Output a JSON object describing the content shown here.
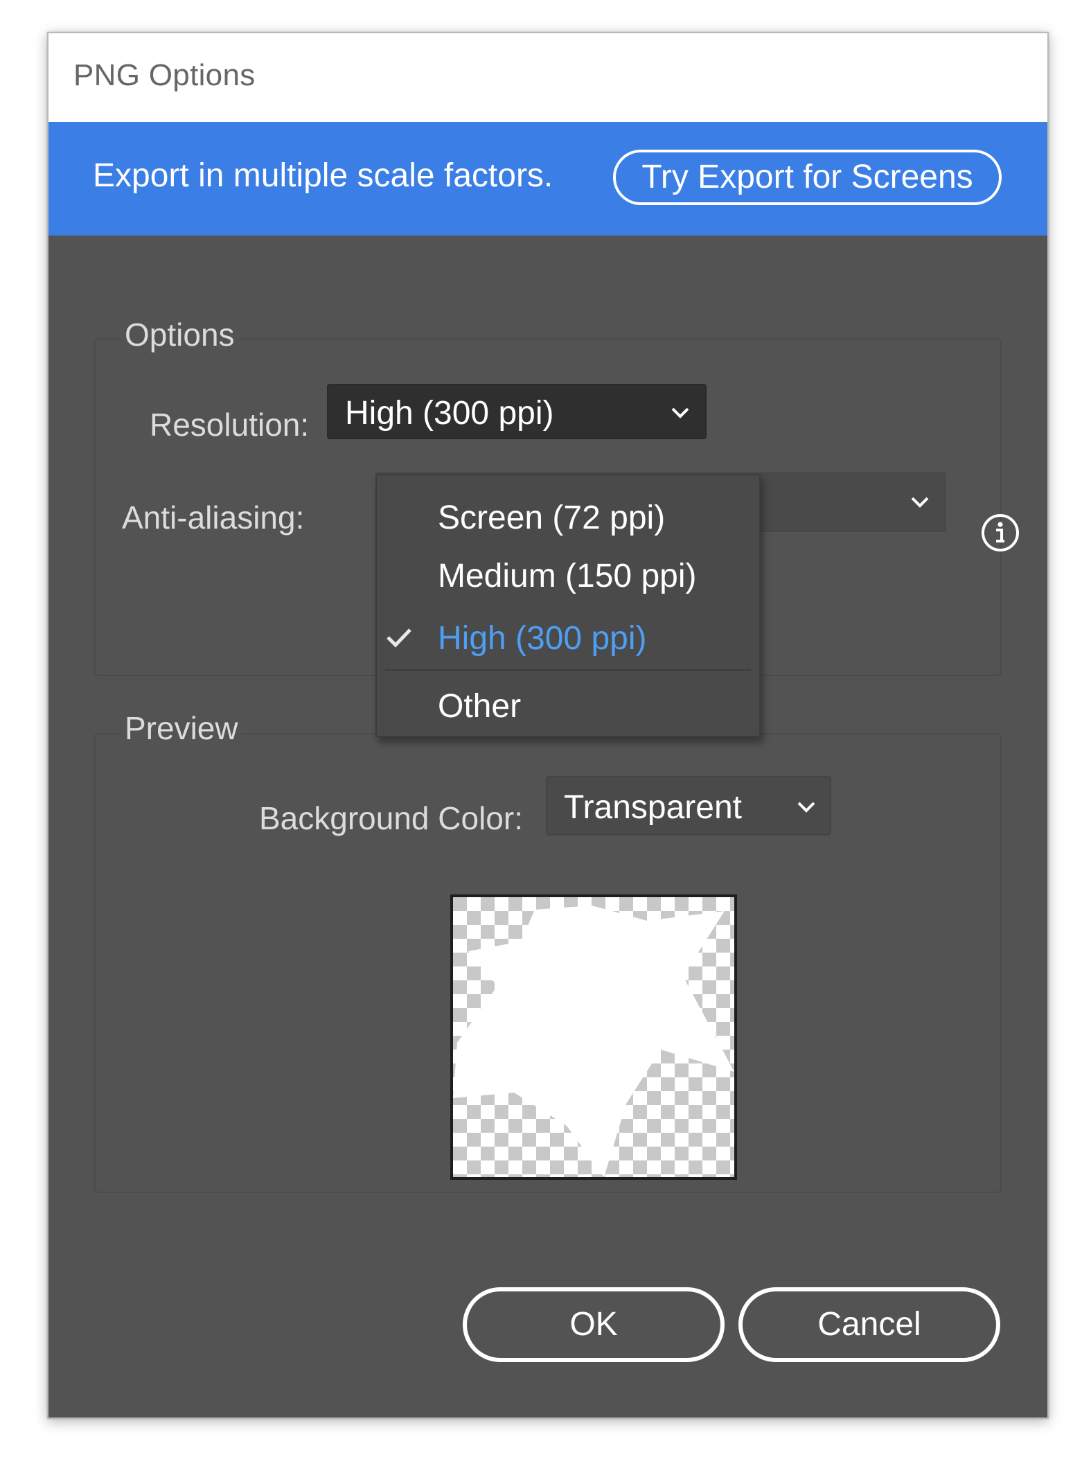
{
  "dialog": {
    "title": "PNG Options"
  },
  "banner": {
    "text": "Export in multiple scale factors.",
    "button_label": "Try Export for Screens",
    "color": "#3b7ee6"
  },
  "options": {
    "group_label": "Options",
    "resolution": {
      "label": "Resolution:",
      "value": "High (300 ppi)",
      "menu_open": true,
      "menu_items": [
        {
          "label": "Screen (72 ppi)",
          "selected": false
        },
        {
          "label": "Medium (150 ppi)",
          "selected": false
        },
        {
          "label": "High (300 ppi)",
          "selected": true
        },
        {
          "label": "Other",
          "selected": false
        }
      ]
    },
    "anti_aliasing": {
      "label": "Anti-aliasing:"
    },
    "info_icon": "info-icon"
  },
  "preview": {
    "group_label": "Preview",
    "background_color": {
      "label": "Background Color:",
      "value": "Transparent"
    }
  },
  "buttons": {
    "ok": "OK",
    "cancel": "Cancel"
  },
  "colors": {
    "dialog_bg": "#535353",
    "selected_item": "#4e9ef3"
  }
}
